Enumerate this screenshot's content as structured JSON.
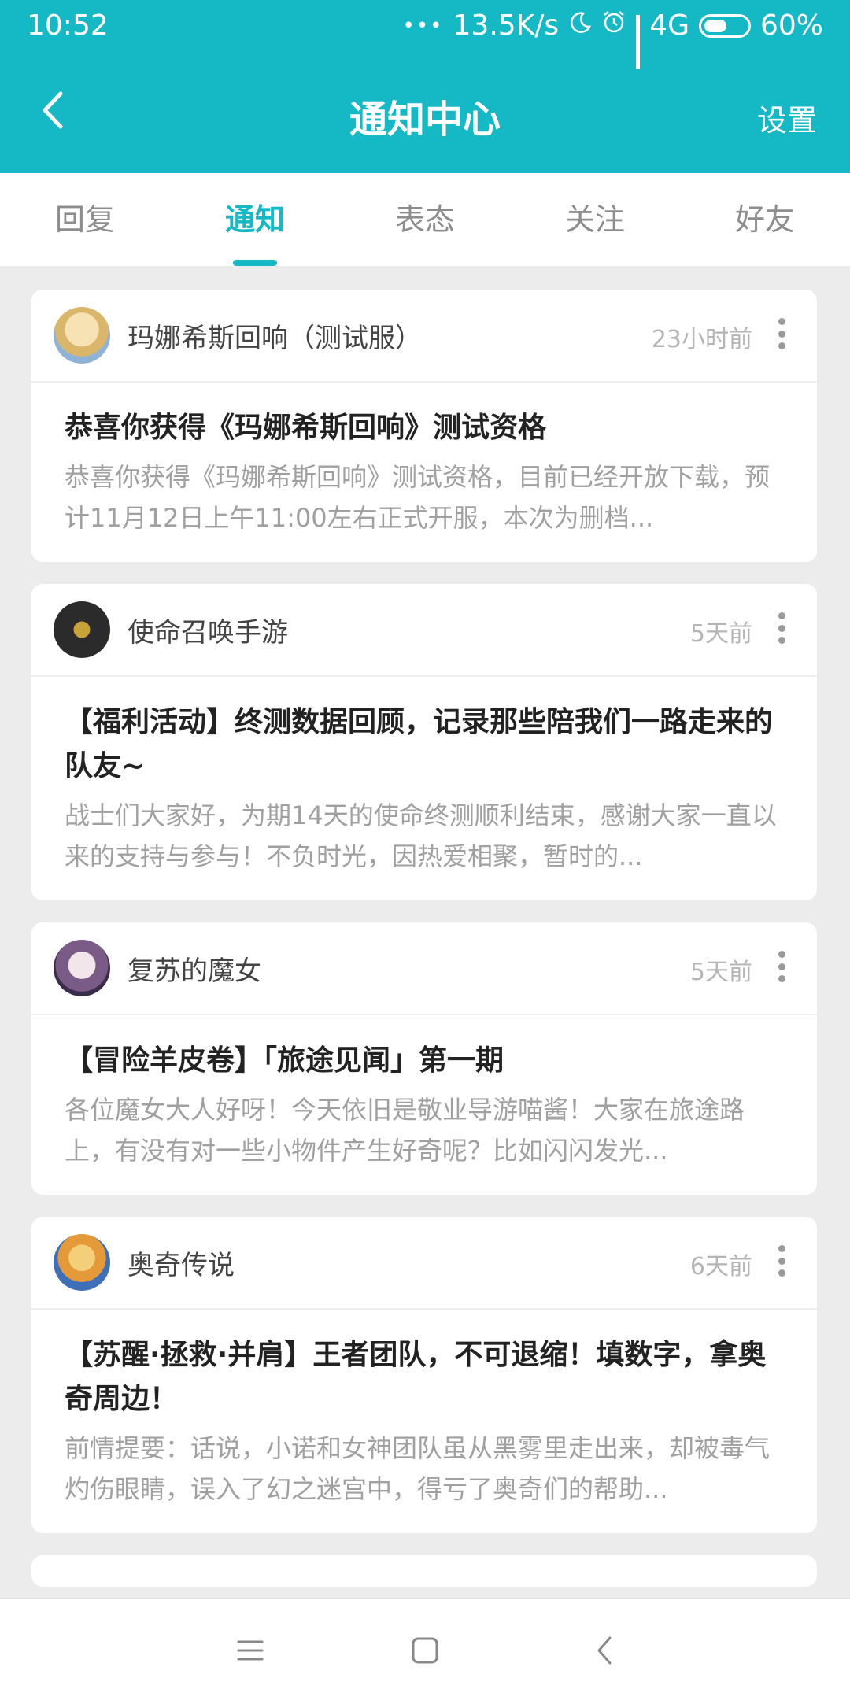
{
  "status": {
    "time": "10:52",
    "dots": "•••",
    "speed": "13.5K/s",
    "network": "4G",
    "battery": "60%",
    "battery_level": 0.6
  },
  "nav": {
    "title": "通知中心",
    "settings": "设置"
  },
  "tabs": [
    "回复",
    "通知",
    "表态",
    "关注",
    "好友"
  ],
  "active_tab": 1,
  "colors": {
    "accent": "#14b9c5"
  },
  "cards": [
    {
      "source": "玛娜希斯回响（测试服）",
      "time": "23小时前",
      "title": "恭喜你获得《玛娜希斯回响》测试资格",
      "snippet": "恭喜你获得《玛娜希斯回响》测试资格，目前已经开放下载，预计11月12日上午11:00左右正式开服，本次为删档..."
    },
    {
      "source": "使命召唤手游",
      "time": "5天前",
      "title": "【福利活动】终测数据回顾，记录那些陪我们一路走来的队友~",
      "snippet": "战士们大家好，为期14天的使命终测顺利结束，感谢大家一直以来的支持与参与！不负时光，因热爱相聚，暂时的..."
    },
    {
      "source": "复苏的魔女",
      "time": "5天前",
      "title": "【冒险羊皮卷】「旅途见闻」第一期",
      "snippet": "各位魔女大人好呀！今天依旧是敬业导游喵酱！大家在旅途路上，有没有对一些小物件产生好奇呢？比如闪闪发光..."
    },
    {
      "source": "奥奇传说",
      "time": "6天前",
      "title": "【苏醒·拯救·并肩】王者团队，不可退缩！填数字，拿奥奇周边！",
      "snippet": "前情提要：话说，小诺和女神团队虽从黑雾里走出来，却被毒气灼伤眼睛，误入了幻之迷宫中，得亏了奥奇们的帮助..."
    }
  ],
  "icons": {
    "back": "chevron-left-icon",
    "moon": "moon-icon",
    "alarm": "alarm-icon",
    "signal": "signal-icon",
    "more": "more-vertical-icon",
    "menu": "menu-icon",
    "home": "home-square-icon",
    "sys_back": "system-back-icon"
  }
}
